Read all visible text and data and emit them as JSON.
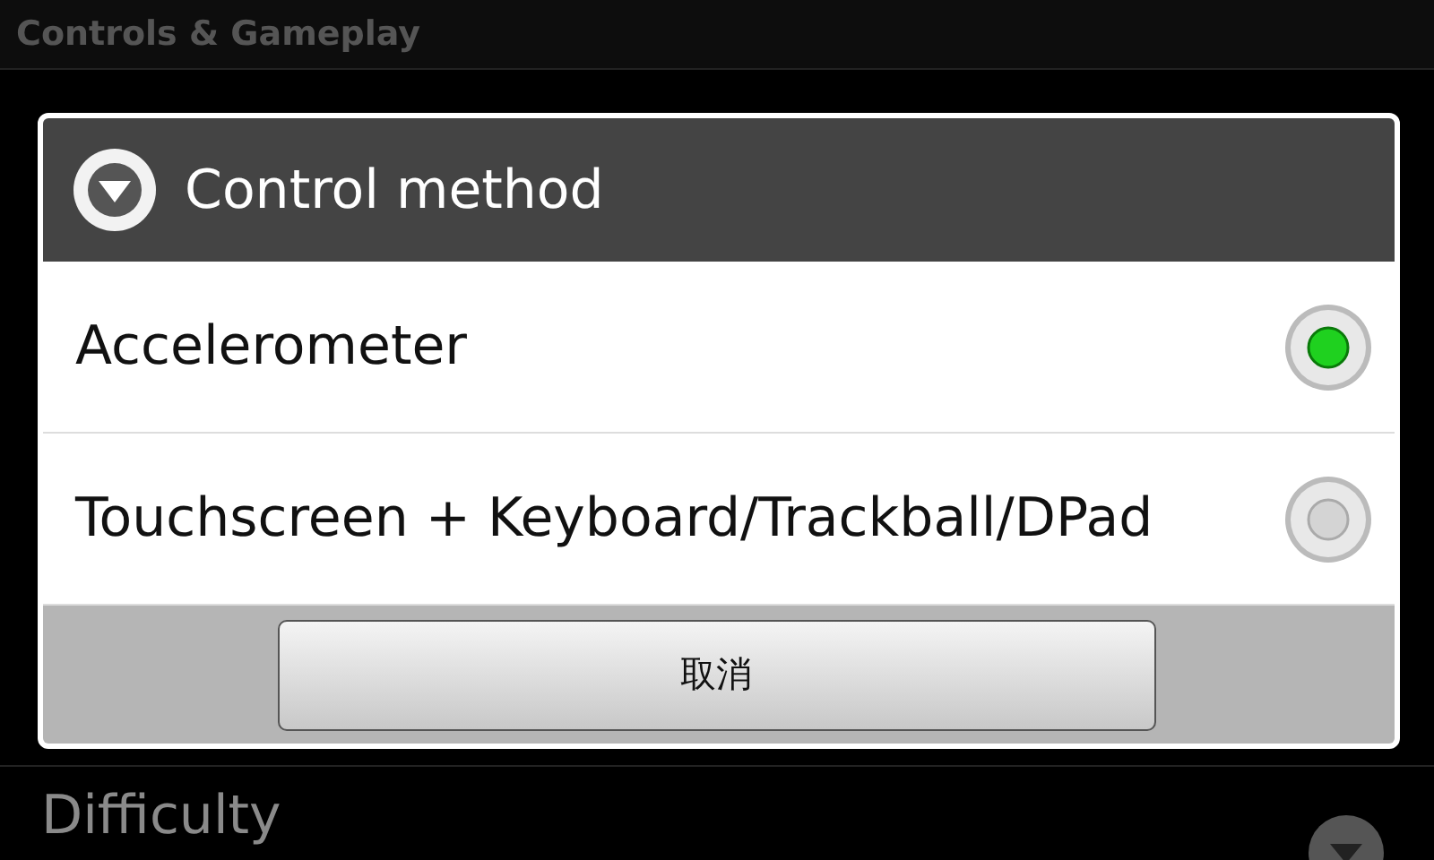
{
  "screen": {
    "title": "Controls & Gameplay"
  },
  "background_items": [
    {
      "title": "Difficulty"
    }
  ],
  "dialog": {
    "title": "Control method",
    "options": [
      {
        "label": "Accelerometer",
        "selected": true
      },
      {
        "label": "Touchscreen + Keyboard/Trackball/DPad",
        "selected": false
      }
    ],
    "cancel_button": "取消"
  }
}
